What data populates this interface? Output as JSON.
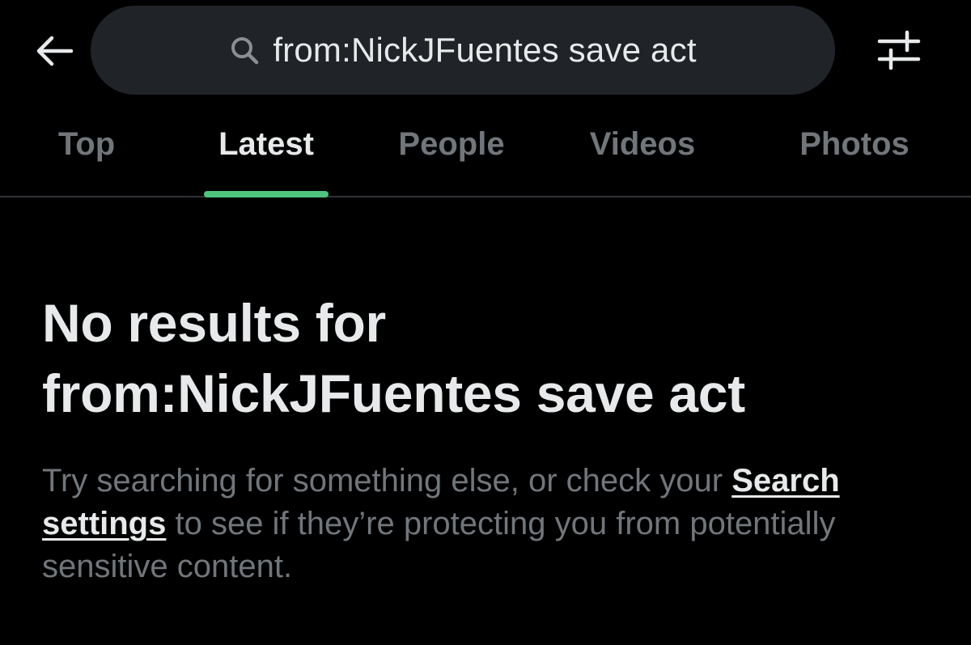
{
  "colors": {
    "background": "#000000",
    "search_field": "#202327",
    "text_primary": "#e7e9ea",
    "text_secondary": "#71767b",
    "divider": "#2f3336",
    "tab_indicator": "#4ec47f"
  },
  "header": {
    "back_icon": "arrow-left-icon",
    "search_icon": "search-icon",
    "search_query": "from:NickJFuentes save act",
    "filter_icon": "sliders-icon"
  },
  "tabs": [
    {
      "label": "Top",
      "active": false
    },
    {
      "label": "Latest",
      "active": true
    },
    {
      "label": "People",
      "active": false
    },
    {
      "label": "Videos",
      "active": false
    },
    {
      "label": "Photos",
      "active": false
    }
  ],
  "empty_state": {
    "title_line1": "No results for",
    "title_line2": "from:NickJFuentes save act",
    "desc_before_link": "Try searching for something else, or check your ",
    "link_text": "Search settings",
    "desc_after_link": " to see if they’re protecting you from potentially sensitive content."
  }
}
